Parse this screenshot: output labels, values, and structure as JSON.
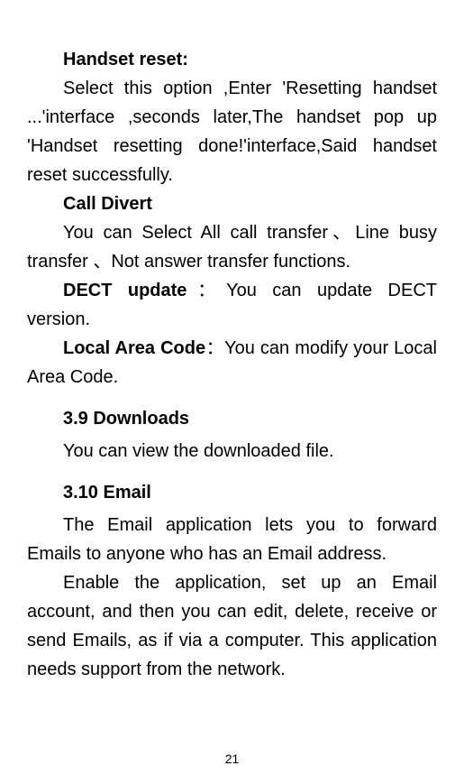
{
  "sections": {
    "handset_reset": {
      "title": "Handset reset:",
      "body": "Select this option ,Enter 'Resetting handset ...'interface ,seconds later,The handset pop up 'Handset resetting done!'interface,Said handset reset  successfully."
    },
    "call_divert": {
      "title": "Call Divert",
      "body": "You can Select All call transfer、Line busy transfer 、Not answer transfer functions."
    },
    "dect_update": {
      "label": "DECT update",
      "sep": "：",
      "body": "You can update DECT version."
    },
    "local_area_code": {
      "label": "Local Area Code",
      "sep": "：",
      "body": "You can modify your Local Area Code."
    },
    "downloads": {
      "heading": "3.9  Downloads",
      "body": "You can view the downloaded file."
    },
    "email": {
      "heading": "3.10  Email",
      "body1": "The Email application lets you to forward Emails to anyone who has an Email address.",
      "body2": "Enable the application, set up an Email account, and then you can edit, delete, receive or send Emails, as if via a computer. This application needs support from the network."
    }
  },
  "page_number": "21"
}
